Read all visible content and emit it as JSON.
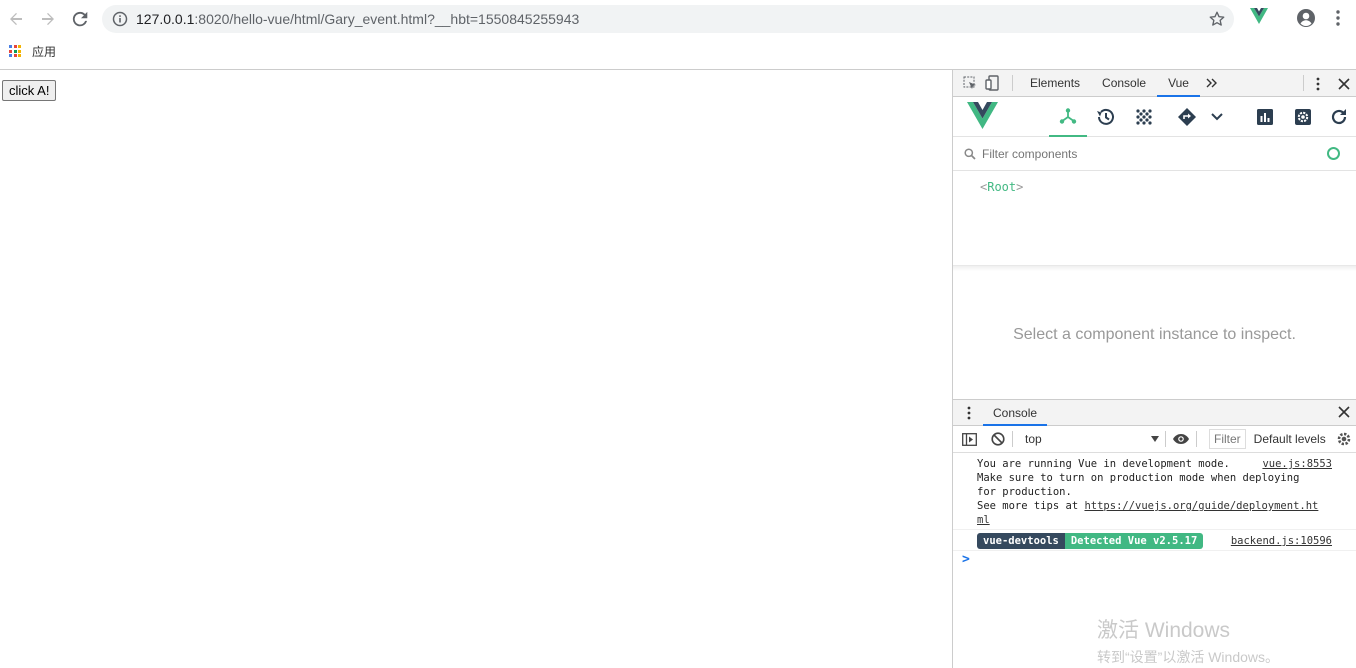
{
  "browser": {
    "url_host": "127.0.0.1",
    "url_path": ":8020/hello-vue/html/Gary_event.html?__hbt=1550845255943",
    "bookmark_apps_label": "应用"
  },
  "page": {
    "button_label": "click A!"
  },
  "devtools": {
    "tabs": [
      "Elements",
      "Console",
      "Vue"
    ],
    "active_tab": "Vue",
    "filter_placeholder": "Filter components",
    "root_open": "<",
    "root_name": "Root",
    "root_close": ">",
    "inspect_hint": "Select a component instance to inspect.",
    "drawer_tab": "Console",
    "context": "top",
    "filter_label": "Filter",
    "levels_label": "Default levels",
    "log": {
      "line1": "You are running Vue in development mode.",
      "source1": "vue.js:8553",
      "line2": "Make sure to turn on production mode when deploying",
      "line3": "for production.",
      "line4_prefix": "See more tips at ",
      "line4_link_a": "https://vuejs.org/guide/deployment.ht",
      "line4_link_b": "ml",
      "badge_left": "vue-devtools",
      "badge_right": "Detected Vue v2.5.17",
      "source2": "backend.js:10596",
      "prompt": ">"
    },
    "accent_color": "#42b983"
  },
  "watermark": {
    "line1": "激活 Windows",
    "line2": "转到“设置”以激活 Windows。"
  }
}
